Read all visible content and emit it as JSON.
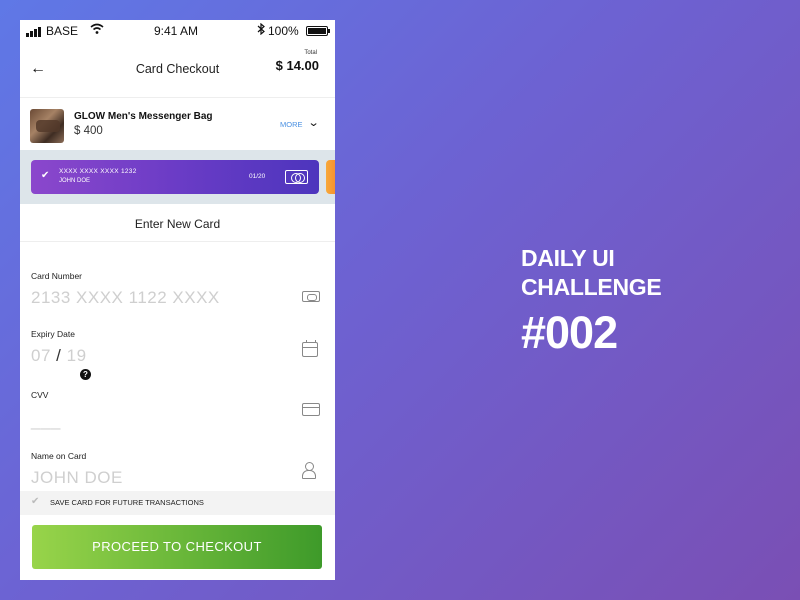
{
  "status_bar": {
    "carrier": "BASE",
    "time": "9:41 AM",
    "bluetooth": "∗",
    "battery": "100%"
  },
  "header": {
    "back_icon": "←",
    "title": "Card Checkout",
    "total_label": "Total",
    "total_value": "$ 14.00"
  },
  "product": {
    "name": "GLOW Men's Messenger Bag",
    "price": "$ 400",
    "more_label": "MORE",
    "chevron": "⌄"
  },
  "saved_card": {
    "check": "✔",
    "number": "XXXX XXXX XXXX 1232",
    "holder": "JOHN DOE",
    "expiry": "01/20"
  },
  "section_title": "Enter New Card",
  "fields": {
    "card_number": {
      "label": "Card Number",
      "placeholder": "2133 XXXX 1122 XXXX"
    },
    "expiry": {
      "label": "Expiry Date",
      "month": "07",
      "separator": "/",
      "year": "19"
    },
    "cvv": {
      "label": "CVV",
      "help": "?",
      "placeholder": "___"
    },
    "name": {
      "label": "Name on Card",
      "placeholder": "JOHN DOE"
    }
  },
  "save_card": {
    "check": "✔",
    "label": "SAVE CARD FOR FUTURE TRANSACTIONS"
  },
  "cta": {
    "label": "PROCEED TO CHECKOUT"
  },
  "banner": {
    "line1": "DAILY UI",
    "line2": "CHALLENGE",
    "number": "#002"
  },
  "colors": {
    "card_gradient_start": "#8b47cc",
    "card_gradient_end": "#4d35bd",
    "cta_start": "#98d44a",
    "cta_end": "#3e9a2a",
    "link": "#4a90e2"
  }
}
